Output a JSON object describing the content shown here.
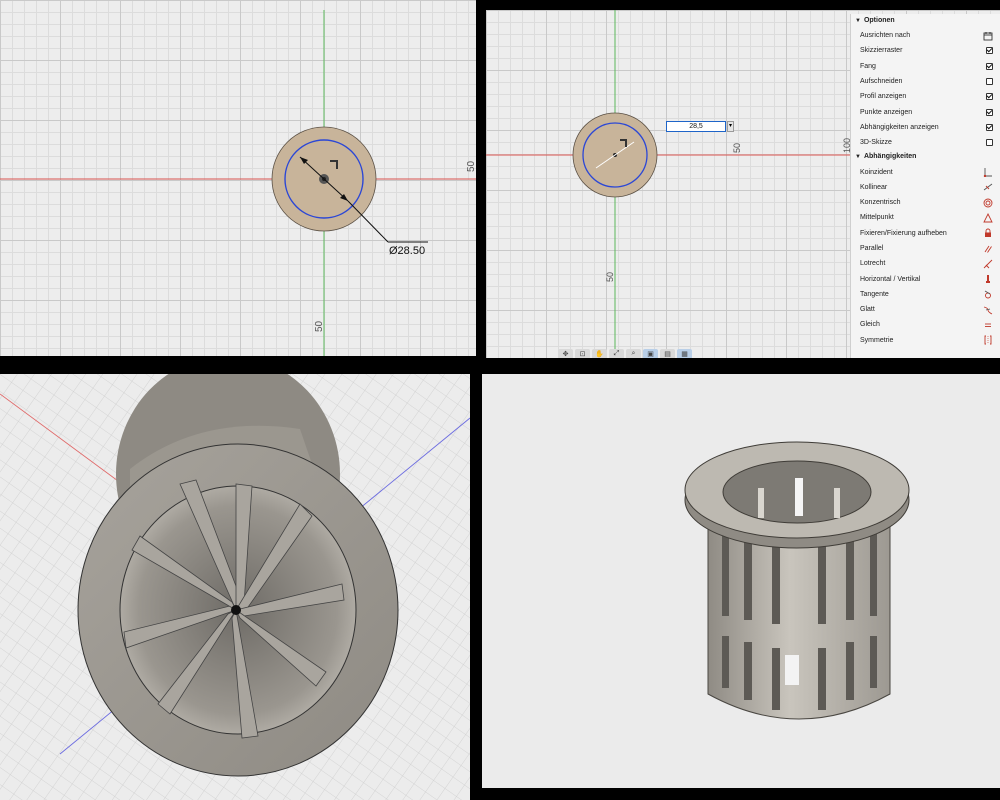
{
  "sketch_view_1": {
    "dimension_label": "Ø28.50",
    "axis_label_right": "50",
    "axis_label_bottom": "50"
  },
  "sketch_view_2": {
    "dimension_input_value": "28,5",
    "axis_label_right": "50",
    "axis_label_bottom": "50",
    "axis_label_edge": "100",
    "toolbar_icons": [
      "orbit-icon",
      "pan-icon",
      "hand-icon",
      "zoom-fit-icon",
      "zoom-icon",
      "display-icon",
      "visual-style-icon",
      "grid-icon"
    ]
  },
  "palette": {
    "options_header": "Optionen",
    "options": [
      {
        "label": "Ausrichten nach",
        "control": "calendar-icon"
      },
      {
        "label": "Skizzierraster",
        "checked": true
      },
      {
        "label": "Fang",
        "checked": true
      },
      {
        "label": "Aufschneiden",
        "checked": false
      },
      {
        "label": "Profil anzeigen",
        "checked": true
      },
      {
        "label": "Punkte anzeigen",
        "checked": true
      },
      {
        "label": "Abhängigkeiten anzeigen",
        "checked": true
      },
      {
        "label": "3D-Skizze",
        "checked": false
      }
    ],
    "constraints_header": "Abhängigkeiten",
    "constraints": [
      {
        "label": "Koinzident",
        "icon": "coincident-icon"
      },
      {
        "label": "Kollinear",
        "icon": "collinear-icon"
      },
      {
        "label": "Konzentrisch",
        "icon": "concentric-icon"
      },
      {
        "label": "Mittelpunkt",
        "icon": "midpoint-icon"
      },
      {
        "label": "Fixieren/Fixierung aufheben",
        "icon": "lock-icon"
      },
      {
        "label": "Parallel",
        "icon": "parallel-icon"
      },
      {
        "label": "Lotrecht",
        "icon": "perpendicular-icon"
      },
      {
        "label": "Horizontal / Vertikal",
        "icon": "horizontal-vertical-icon"
      },
      {
        "label": "Tangente",
        "icon": "tangent-icon"
      },
      {
        "label": "Glatt",
        "icon": "smooth-icon"
      },
      {
        "label": "Gleich",
        "icon": "equal-icon"
      },
      {
        "label": "Symmetrie",
        "icon": "symmetry-icon"
      }
    ]
  },
  "colors": {
    "canvas": "#ededed",
    "x_axis": "#d9534f",
    "y_axis": "#5cb85c",
    "sketch_profile": "#c8b49a",
    "sketch_curve": "#2b47d6",
    "model_body": "#b8b4ac",
    "constraint_icon": "#c0392b"
  }
}
